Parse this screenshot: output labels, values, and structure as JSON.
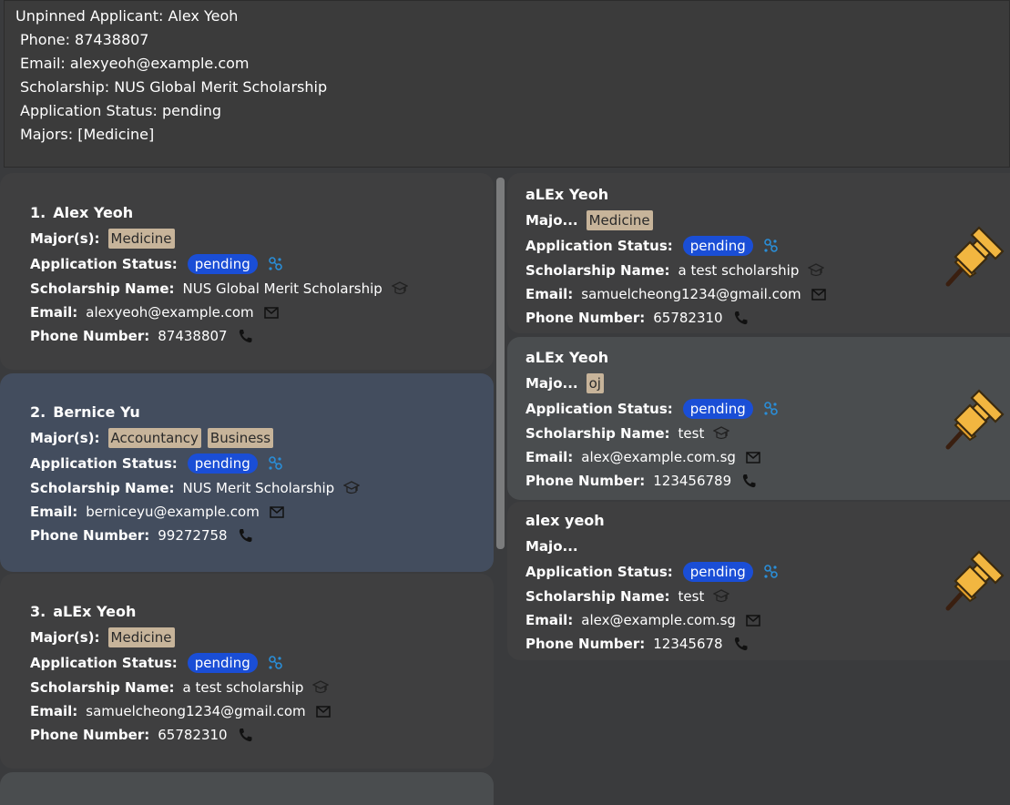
{
  "result_display": {
    "lines": [
      "Unpinned Applicant: Alex Yeoh",
      "Phone: 87438807",
      "Email: alexyeoh@example.com",
      "Scholarship: NUS Global Merit Scholarship",
      "Application Status: pending",
      "Majors: [Medicine]"
    ]
  },
  "labels": {
    "majors": "Major(s):",
    "majors_short": "Majo...",
    "status": "Application Status:",
    "scholarship": "Scholarship Name:",
    "email": "Email:",
    "phone": "Phone Number:"
  },
  "applicants": [
    {
      "index": "1.",
      "name": "Alex Yeoh",
      "majors": [
        "Medicine"
      ],
      "status": "pending",
      "scholarship": "NUS Global Merit Scholarship",
      "email": "alexyeoh@example.com",
      "phone": "87438807"
    },
    {
      "index": "2.",
      "name": "Bernice Yu",
      "majors": [
        "Accountancy",
        "Business"
      ],
      "status": "pending",
      "scholarship": "NUS Merit Scholarship",
      "email": "berniceyu@example.com",
      "phone": "99272758"
    },
    {
      "index": "3.",
      "name": "aLEx Yeoh",
      "majors": [
        "Medicine"
      ],
      "status": "pending",
      "scholarship": "a test scholarship",
      "email": "samuelcheong1234@gmail.com",
      "phone": "65782310"
    }
  ],
  "pinned": [
    {
      "name": "aLEx Yeoh",
      "majors": [
        "Medicine"
      ],
      "status": "pending",
      "scholarship": "a test scholarship",
      "email": "samuelcheong1234@gmail.com",
      "phone": "65782310"
    },
    {
      "name": "aLEx Yeoh",
      "majors": [
        "oj"
      ],
      "status": "pending",
      "scholarship": "test",
      "email": "alex@example.com.sg",
      "phone": "123456789"
    },
    {
      "name": "alex yeoh",
      "majors": [],
      "status": "pending",
      "scholarship": "test",
      "email": "alex@example.com.sg",
      "phone": "12345678"
    }
  ],
  "icons": {
    "status": "status-network-icon",
    "scholarship": "graduation-cap-icon",
    "email": "envelope-icon",
    "phone": "phone-icon",
    "pin": "pushpin-icon"
  },
  "colors": {
    "badge": "#1a4ed6",
    "tag": "#c7b49a",
    "selected_card": "#434d5e",
    "pin": "#f2b640"
  }
}
